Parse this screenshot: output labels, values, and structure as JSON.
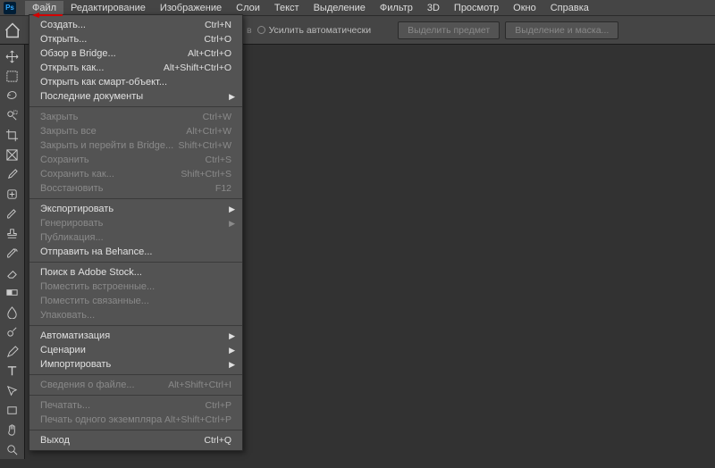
{
  "menubar": {
    "items": [
      {
        "label": "Файл",
        "open": true
      },
      {
        "label": "Редактирование"
      },
      {
        "label": "Изображение"
      },
      {
        "label": "Слои"
      },
      {
        "label": "Текст"
      },
      {
        "label": "Выделение"
      },
      {
        "label": "Фильтр"
      },
      {
        "label": "3D"
      },
      {
        "label": "Просмотр"
      },
      {
        "label": "Окно"
      },
      {
        "label": "Справка"
      }
    ]
  },
  "optbar": {
    "partial_label": "в",
    "enhance_label": "Усилить автоматически",
    "select_subject": "Выделить предмет",
    "select_and_mask": "Выделение и маска..."
  },
  "dropdown": [
    {
      "label": "Создать...",
      "shortcut": "Ctrl+N"
    },
    {
      "label": "Открыть...",
      "shortcut": "Ctrl+O"
    },
    {
      "label": "Обзор в Bridge...",
      "shortcut": "Alt+Ctrl+O"
    },
    {
      "label": "Открыть как...",
      "shortcut": "Alt+Shift+Ctrl+O"
    },
    {
      "label": "Открыть как смарт-объект..."
    },
    {
      "label": "Последние документы",
      "submenu": true
    },
    {
      "sep": true
    },
    {
      "label": "Закрыть",
      "shortcut": "Ctrl+W",
      "disabled": true
    },
    {
      "label": "Закрыть все",
      "shortcut": "Alt+Ctrl+W",
      "disabled": true
    },
    {
      "label": "Закрыть и перейти в Bridge...",
      "shortcut": "Shift+Ctrl+W",
      "disabled": true
    },
    {
      "label": "Сохранить",
      "shortcut": "Ctrl+S",
      "disabled": true
    },
    {
      "label": "Сохранить как...",
      "shortcut": "Shift+Ctrl+S",
      "disabled": true
    },
    {
      "label": "Восстановить",
      "shortcut": "F12",
      "disabled": true
    },
    {
      "sep": true
    },
    {
      "label": "Экспортировать",
      "submenu": true
    },
    {
      "label": "Генерировать",
      "submenu": true,
      "disabled": true
    },
    {
      "label": "Публикация...",
      "disabled": true
    },
    {
      "label": "Отправить на Behance..."
    },
    {
      "sep": true
    },
    {
      "label": "Поиск в Adobe Stock..."
    },
    {
      "label": "Поместить встроенные...",
      "disabled": true
    },
    {
      "label": "Поместить связанные...",
      "disabled": true
    },
    {
      "label": "Упаковать...",
      "disabled": true
    },
    {
      "sep": true
    },
    {
      "label": "Автоматизация",
      "submenu": true
    },
    {
      "label": "Сценарии",
      "submenu": true
    },
    {
      "label": "Импортировать",
      "submenu": true
    },
    {
      "sep": true
    },
    {
      "label": "Сведения о файле...",
      "shortcut": "Alt+Shift+Ctrl+I",
      "disabled": true
    },
    {
      "sep": true
    },
    {
      "label": "Печатать...",
      "shortcut": "Ctrl+P",
      "disabled": true
    },
    {
      "label": "Печать одного экземпляра",
      "shortcut": "Alt+Shift+Ctrl+P",
      "disabled": true
    },
    {
      "sep": true
    },
    {
      "label": "Выход",
      "shortcut": "Ctrl+Q"
    }
  ],
  "tools": [
    "move",
    "marquee",
    "lasso",
    "quick-select",
    "crop",
    "frame",
    "eyedropper",
    "healing",
    "brush",
    "stamp",
    "history-brush",
    "eraser",
    "gradient",
    "blur",
    "dodge",
    "pen",
    "type",
    "path-select",
    "rectangle",
    "hand",
    "zoom"
  ]
}
